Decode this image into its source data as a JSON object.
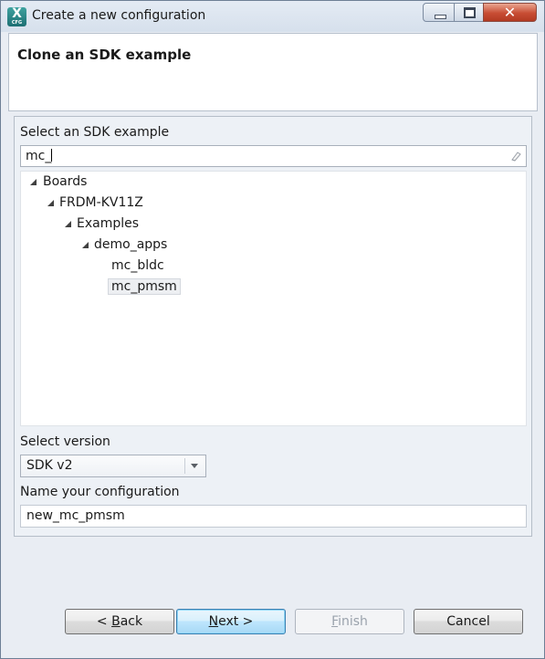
{
  "window": {
    "title": "Create a new configuration",
    "app_icon_letter": "X",
    "app_icon_caption": "CFG",
    "controls": {
      "minimize": "minimize-icon",
      "maximize": "maximize-icon",
      "close": "close-icon"
    }
  },
  "header": {
    "title": "Clone an SDK example"
  },
  "example_section": {
    "label": "Select an SDK example",
    "search_value": "mc_",
    "clear_icon": "clear-filter-icon"
  },
  "tree": {
    "boards": "Boards",
    "board": "FRDM-KV11Z",
    "examples": "Examples",
    "category": "demo_apps",
    "item_1": "mc_bldc",
    "item_2": "mc_pmsm",
    "selected": "mc_pmsm"
  },
  "version_section": {
    "label": "Select version",
    "selected": "SDK v2"
  },
  "name_section": {
    "label": "Name your configuration",
    "value": "new_mc_pmsm"
  },
  "buttons": {
    "back_prefix": "< ",
    "back_mnemonic": "B",
    "back_rest": "ack",
    "next_mnemonic": "N",
    "next_rest": "ext >",
    "finish_mnemonic": "F",
    "finish_rest": "inish",
    "cancel": "Cancel",
    "default_button": "next",
    "disabled_button": "finish"
  },
  "colors": {
    "window_bg": "#e9edf3",
    "default_button_border": "#3c7fb1",
    "close_button": "#c84d34",
    "disabled_text": "#9ba3ad"
  }
}
